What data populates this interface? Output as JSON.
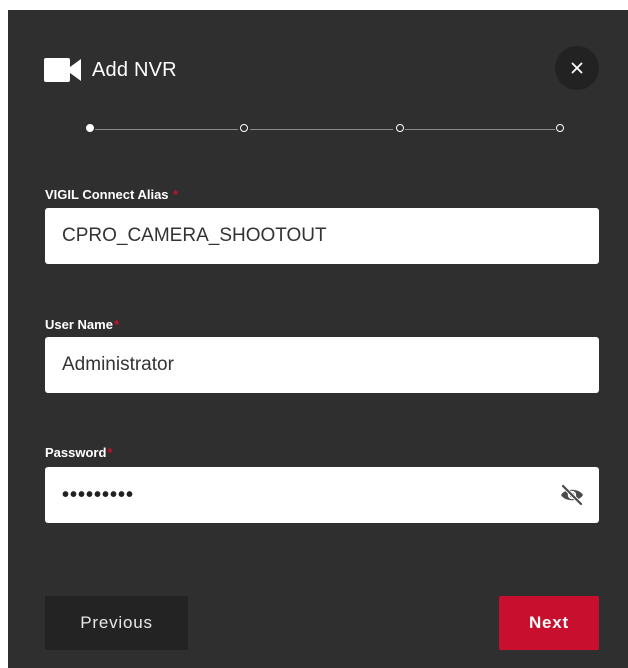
{
  "dialog": {
    "title": "Add NVR",
    "title_icon": "video-camera-icon",
    "close_icon": "close-icon",
    "close_label": "×"
  },
  "stepper": {
    "total_steps": 4,
    "current_step": 1
  },
  "fields": {
    "alias": {
      "label": "VIGIL Connect Alias",
      "required_mark": "*",
      "value": "CPRO_CAMERA_SHOOTOUT"
    },
    "username": {
      "label": "User Name",
      "required_mark": "*",
      "value": "Administrator"
    },
    "password": {
      "label": "Password",
      "required_mark": "*",
      "masked_value": "•••••••••",
      "toggle_icon": "eye-slash-icon"
    }
  },
  "buttons": {
    "previous_label": "Previous",
    "next_label": "Next"
  },
  "colors": {
    "dialog_bg": "#2f2f2f",
    "accent": "#c8102e",
    "input_bg": "#ffffff"
  }
}
